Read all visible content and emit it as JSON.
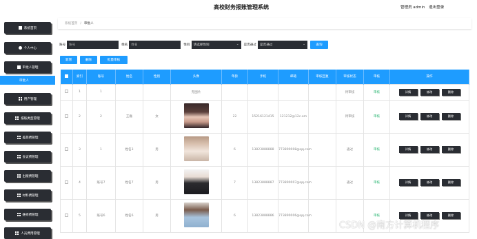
{
  "header": {
    "title": "高校财务报账管理系统",
    "user_text": "管理员 admin",
    "logout": "退出登录"
  },
  "sidebar": {
    "items": [
      {
        "label": "系统首页",
        "icon": "home-icon"
      },
      {
        "label": "个人中心",
        "icon": "person-icon"
      },
      {
        "label": "审批人管理",
        "icon": "document-icon"
      },
      {
        "label": "用户管理",
        "icon": "grid-icon"
      },
      {
        "label": "报账类型管理",
        "icon": "grid-icon"
      },
      {
        "label": "差旅费管理",
        "icon": "grid-icon"
      },
      {
        "label": "会议费管理",
        "icon": "grid-icon"
      },
      {
        "label": "出版费管理",
        "icon": "grid-icon"
      },
      {
        "label": "材料费管理",
        "icon": "grid-icon"
      },
      {
        "label": "维修费管理",
        "icon": "grid-icon"
      },
      {
        "label": "人员费用管理",
        "icon": "grid-icon"
      }
    ],
    "active_sub": "审批人"
  },
  "breadcrumb": {
    "home": "系统首页",
    "sep": "/",
    "current": "审批人"
  },
  "search": {
    "account_label": "账号",
    "account_placeholder": "账号",
    "name_label": "姓名",
    "name_placeholder": "姓名",
    "gender_label": "性别",
    "gender_value": "请选择性别",
    "pass_label": "是否通过",
    "pass_value": "是否通过",
    "search_button": "查询"
  },
  "actions": {
    "add": "新增",
    "delete": "删除",
    "batch_review": "批量审核"
  },
  "table": {
    "columns": [
      "索引",
      "账号",
      "姓名",
      "性别",
      "头像",
      "年龄",
      "手机",
      "邮箱",
      "审核回复",
      "审核状态",
      "审核",
      "操作"
    ],
    "rows": [
      {
        "index": "1",
        "account": "1",
        "name": "",
        "gender": "",
        "avatar": "无图片",
        "age": "",
        "phone": "",
        "email": "",
        "reply": "",
        "status": "待审核",
        "review": "审核"
      },
      {
        "index": "2",
        "account": "2",
        "name": "王磊",
        "gender": "女",
        "avatar": "",
        "age": "22",
        "phone": "15216121415",
        "email": "121212@12c.om",
        "reply": "",
        "status": "待审核",
        "review": "审核"
      },
      {
        "index": "3",
        "account": "1",
        "name": "姓名3",
        "gender": "男",
        "avatar": "",
        "age": "6",
        "phone": "13823888888",
        "email": "773890008@qq.com",
        "reply": "",
        "status": "通过",
        "review": "审核"
      },
      {
        "index": "4",
        "account": "账号7",
        "name": "姓名7",
        "gender": "男",
        "avatar": "",
        "age": "7",
        "phone": "13823888887",
        "email": "773890007@qq.com",
        "reply": "",
        "status": "通过",
        "review": "审核"
      },
      {
        "index": "5",
        "account": "账号6",
        "name": "姓名6",
        "gender": "男",
        "avatar": "",
        "age": "6",
        "phone": "13823888886",
        "email": "773890006@qq.com",
        "reply": "",
        "status": "",
        "review": "审核"
      }
    ],
    "op_detail": "详情",
    "op_edit": "修改",
    "op_delete": "删除"
  },
  "watermark": "CSDN @南方计算机程序"
}
